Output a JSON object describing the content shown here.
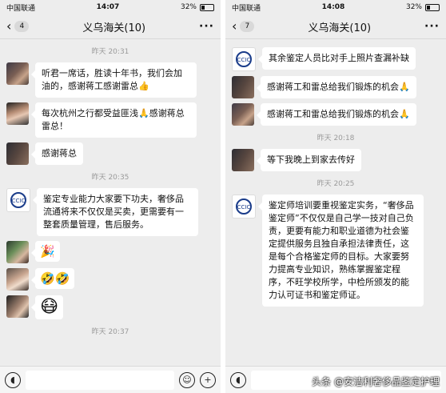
{
  "left": {
    "status": {
      "carrier": "中国联通",
      "time": "14:07",
      "battery": "32%"
    },
    "header": {
      "back_count": "4",
      "title": "义乌海关(10)",
      "more": "···"
    },
    "time1": "昨天 20:31",
    "msg1": "听君一席话，胜读十年书，我们会加油的，感谢蒋工感谢雷总👍",
    "msg2": "每次杭州之行都受益匪浅🙏感谢蒋总雷总！",
    "msg3": "感谢蒋总",
    "time2": "昨天 20:35",
    "msg4": "鉴定专业能力大家要下功夫，奢侈品流通将来不仅仅是买卖，更需要有一整套质量管理，售后服务。",
    "msg5": "🎉",
    "msg6": "🤣🤣",
    "msg7": "😷",
    "time3": "昨天 20:37"
  },
  "right": {
    "status": {
      "carrier": "中国联通",
      "time": "14:08",
      "battery": "32%"
    },
    "header": {
      "back_count": "7",
      "title": "义乌海关(10)",
      "more": "···"
    },
    "msg1": "其余鉴定人员比对手上照片查漏补缺",
    "msg2": "感谢蒋工和雷总给我们锻炼的机会🙏",
    "msg3": "感谢蒋工和雷总给我们锻炼的机会🙏",
    "time1": "昨天 20:18",
    "msg4": "等下我晚上到家去传好",
    "time2": "昨天 20:25",
    "msg5": "鉴定师培训要重视鉴定实务，“奢侈品鉴定师”不仅仅是自己学一技对自己负责，更要有能力和职业道德为社会鉴定提供服务且独自承担法律责任，这是每个合格鉴定师的目标。大家要努力提高专业知识，熟练掌握鉴定程序，不旺学校所学，中检所颁发的能力认可证书和鉴定师证。",
    "watermark": "头条 @安洁利奢侈品鉴定护理"
  },
  "icons": {
    "voice": "voice-icon",
    "emoji": "emoji-icon",
    "plus": "plus-icon",
    "back": "chevron-left-icon",
    "logo": "ccic-logo-icon"
  }
}
